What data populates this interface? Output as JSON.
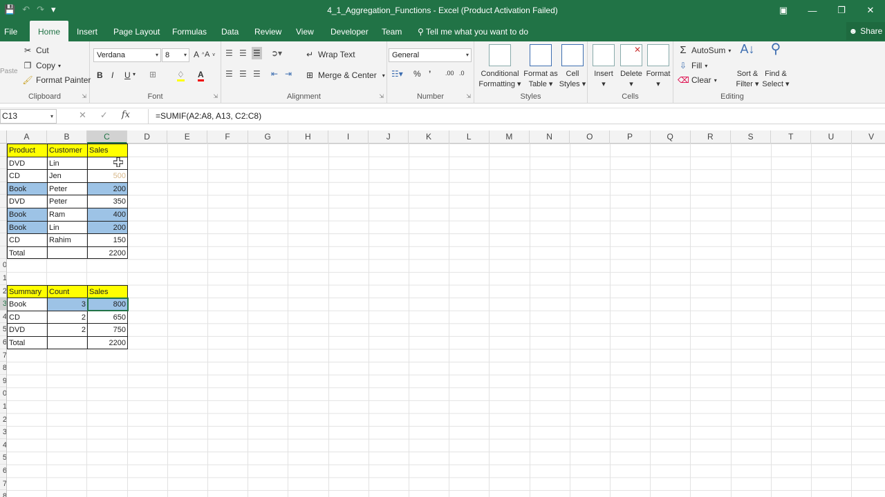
{
  "window": {
    "title": "4_1_Aggregation_Functions - Excel (Product Activation Failed)",
    "qat": [
      "save-icon",
      "undo-icon",
      "redo-icon",
      "customize-icon"
    ]
  },
  "tabs": [
    "File",
    "Home",
    "Insert",
    "Page Layout",
    "Formulas",
    "Data",
    "Review",
    "View",
    "Developer",
    "Team"
  ],
  "tellme": "Tell me what you want to do",
  "share": "Share",
  "ribbon": {
    "clipboard": {
      "paste": "Paste",
      "cut": "Cut",
      "copy": "Copy",
      "format_painter": "Format Painter",
      "label": "Clipboard"
    },
    "font": {
      "family": "Verdana",
      "size": "8",
      "bold": "B",
      "italic": "I",
      "underline": "U",
      "label": "Font"
    },
    "alignment": {
      "wrap_text": "Wrap Text",
      "merge_center": "Merge & Center",
      "label": "Alignment"
    },
    "number": {
      "format": "General",
      "percent": "%",
      "comma": "’",
      "label": "Number"
    },
    "styles": {
      "conditional": [
        "Conditional",
        "Formatting"
      ],
      "format_as": [
        "Format as",
        "Table"
      ],
      "cell_styles": [
        "Cell",
        "Styles"
      ],
      "label": "Styles"
    },
    "cells": {
      "insert": "Insert",
      "delete": "Delete",
      "format": "Format",
      "label": "Cells"
    },
    "editing": {
      "autosum": "AutoSum",
      "fill": "Fill",
      "clear": "Clear",
      "sort": [
        "Sort &",
        "Filter"
      ],
      "find": [
        "Find &",
        "Select"
      ],
      "label": "Editing"
    }
  },
  "formula_bar": {
    "name_box": "C13",
    "formula": "=SUMIF(A2:A8, A13, C2:C8)",
    "fx": "fx"
  },
  "columns": [
    "A",
    "B",
    "C",
    "D",
    "E",
    "F",
    "G",
    "H",
    "I",
    "J",
    "K",
    "L",
    "M",
    "N",
    "O",
    "P",
    "Q",
    "R",
    "S",
    "T",
    "U",
    "V"
  ],
  "row_labels": [
    "",
    "",
    "",
    "",
    "",
    "",
    "",
    "",
    "",
    "0",
    "1",
    "2",
    "3",
    "4",
    "5",
    "6",
    "7",
    "8",
    "9",
    "0",
    "1",
    "2",
    "3",
    "4",
    "5",
    "6",
    "7",
    "8"
  ],
  "table1": {
    "headers": [
      "Product",
      "Customer",
      "Sales"
    ],
    "rows": [
      [
        "DVD",
        "Lin",
        ""
      ],
      [
        "CD",
        "Jen",
        "500"
      ],
      [
        "Book",
        "Peter",
        "200"
      ],
      [
        "DVD",
        "Peter",
        "350"
      ],
      [
        "Book",
        "Ram",
        "400"
      ],
      [
        "Book",
        "Lin",
        "200"
      ],
      [
        "CD",
        "Rahim",
        "150"
      ]
    ],
    "total": [
      "Total",
      "",
      "2200"
    ]
  },
  "table2": {
    "headers": [
      "Summary",
      "Count",
      "Sales"
    ],
    "rows": [
      [
        "Book",
        "3",
        "800"
      ],
      [
        "CD",
        "2",
        "650"
      ],
      [
        "DVD",
        "2",
        "750"
      ]
    ],
    "total": [
      "Total",
      "",
      "2200"
    ]
  },
  "colors": {
    "excel_green": "#217346",
    "header_yellow": "#ffff00",
    "highlight_blue": "#9dc3e6"
  }
}
